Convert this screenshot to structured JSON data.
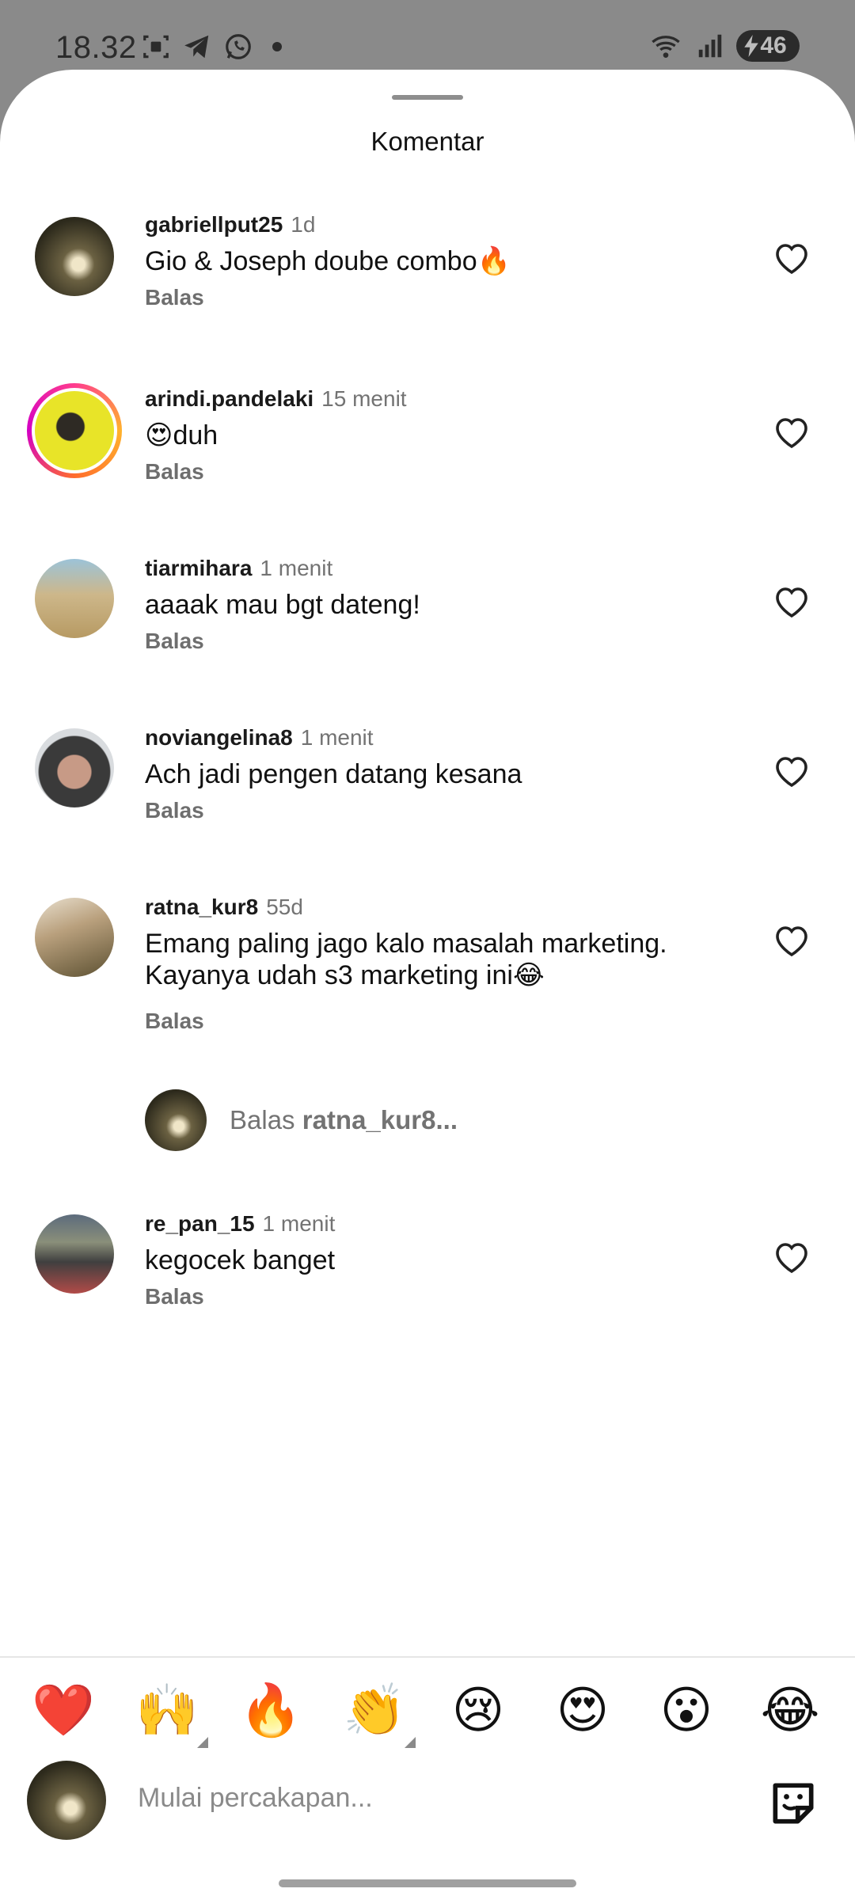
{
  "status_bar": {
    "time": "18.32",
    "battery": "46",
    "icons": [
      "screenshot-icon",
      "telegram-icon",
      "whatsapp-icon",
      "dot-icon",
      "wifi-icon",
      "signal-icon",
      "battery-icon"
    ]
  },
  "sheet": {
    "title": "Komentar"
  },
  "comments": [
    {
      "username": "gabriellput25",
      "time": "1d",
      "text": "Gio & Joseph doube combo🔥",
      "reply_label": "Balas"
    },
    {
      "username": "arindi.pandelaki",
      "time": "15 menit",
      "text": "😍duh",
      "reply_label": "Balas"
    },
    {
      "username": "tiarmihara",
      "time": "1 menit",
      "text": "aaaak mau bgt dateng!",
      "reply_label": "Balas"
    },
    {
      "username": "noviangelina8",
      "time": "1 menit",
      "text": "Ach jadi pengen datang kesana",
      "reply_label": "Balas"
    },
    {
      "username": "ratna_kur8",
      "time": "55d",
      "text_line1": "Emang paling jago kalo masalah marketing.",
      "text_line2": "Kayanya udah s3 marketing ini😂",
      "reply_label": "Balas"
    },
    {
      "username": "re_pan_15",
      "time": "1 menit",
      "text": "kegocek banget",
      "reply_label": "Balas"
    }
  ],
  "reply_prompt": {
    "prefix": "Balas",
    "target": "ratna_kur8..."
  },
  "reactions": [
    "❤️",
    "🙌",
    "🔥",
    "👏",
    "😢",
    "😍",
    "😮",
    "😂"
  ],
  "composer": {
    "placeholder": "Mulai percakapan..."
  }
}
